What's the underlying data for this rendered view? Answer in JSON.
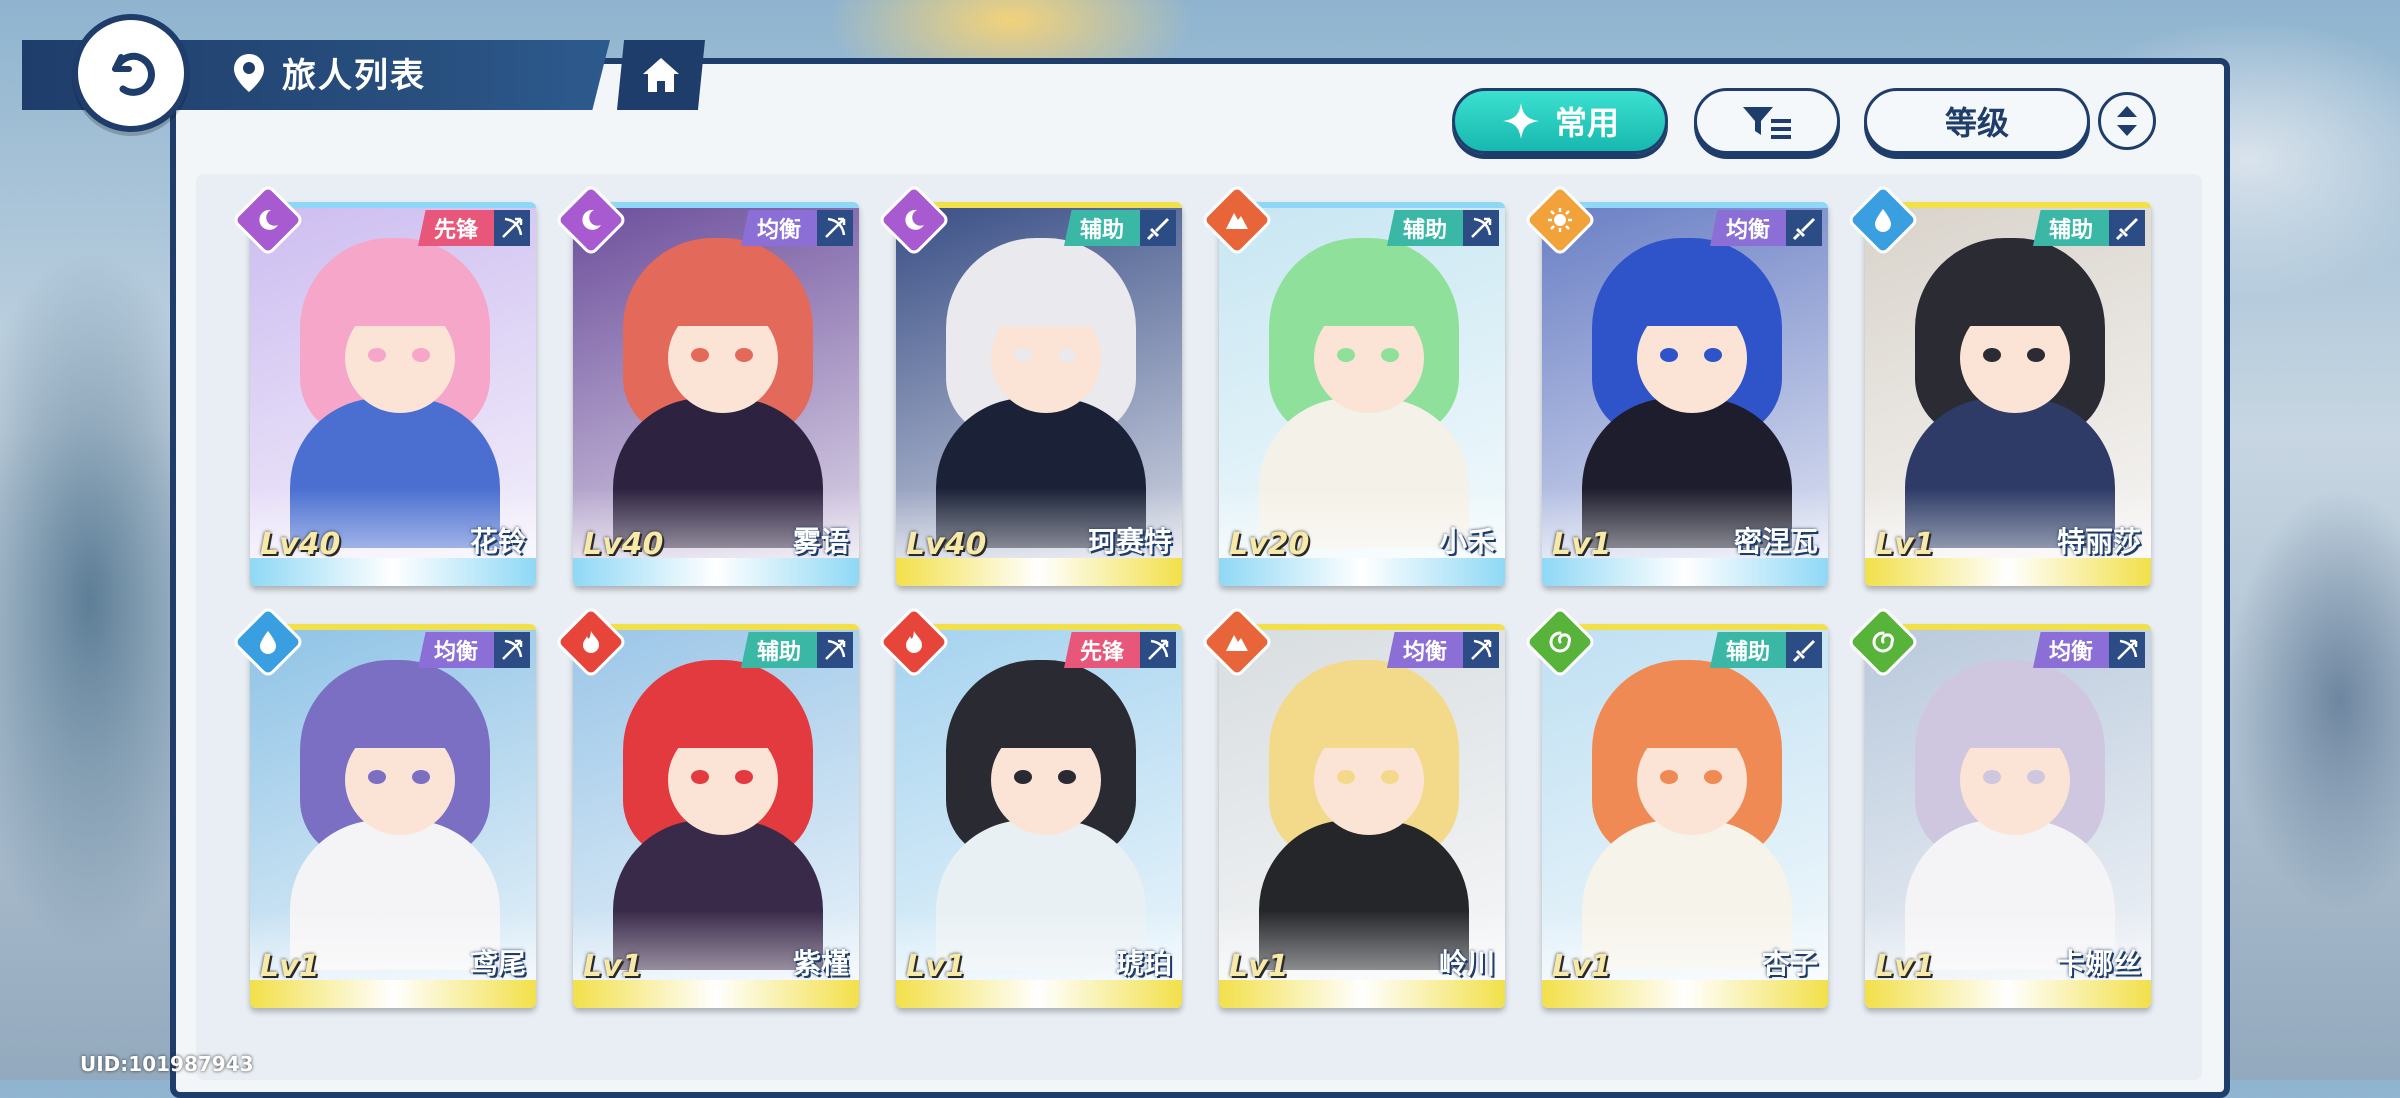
{
  "header": {
    "title": "旅人列表"
  },
  "controls": {
    "common_label": "常用",
    "sort_label": "等级"
  },
  "uid": "UID:101987943",
  "colors": {
    "navy": "#1f3d6b",
    "teal": "#1cc4b9"
  },
  "characters": [
    {
      "name": "花铃",
      "level": "Lv40",
      "role": "先锋",
      "element": "moon",
      "role_color": "#e8577a",
      "rarity_color": "#8fd8f5",
      "hair": "#f6a6c8",
      "outfit": "#4b6fd1",
      "bg": "#cdbdf0",
      "weapon": "bow-icon"
    },
    {
      "name": "雾语",
      "level": "Lv40",
      "role": "均衡",
      "element": "moon",
      "role_color": "#8b6fd6",
      "rarity_color": "#8fd8f5",
      "hair": "#e36a5a",
      "outfit": "#2d2240",
      "bg": "#6d4f9c",
      "weapon": "bow-icon"
    },
    {
      "name": "珂赛特",
      "level": "Lv40",
      "role": "辅助",
      "element": "moon",
      "role_color": "#3bb7a6",
      "rarity_color": "#f2e04a",
      "hair": "#e9e9ee",
      "outfit": "#1b2238",
      "bg": "#3a4f86",
      "weapon": "sword-icon"
    },
    {
      "name": "小禾",
      "level": "Lv20",
      "role": "辅助",
      "element": "earth",
      "role_color": "#3bb7a6",
      "rarity_color": "#8fd8f5",
      "hair": "#8fe09a",
      "outfit": "#f4f1e8",
      "bg": "#c7e6f2",
      "weapon": "bow-icon"
    },
    {
      "name": "密涅瓦",
      "level": "Lv1",
      "role": "均衡",
      "element": "sun",
      "role_color": "#8b6fd6",
      "rarity_color": "#8fd8f5",
      "hair": "#2f54c9",
      "outfit": "#1d1d2d",
      "bg": "#6a7fc5",
      "weapon": "sword-icon"
    },
    {
      "name": "特丽莎",
      "level": "Lv1",
      "role": "辅助",
      "element": "water",
      "role_color": "#3bb7a6",
      "rarity_color": "#f2e04a",
      "hair": "#2b2b34",
      "outfit": "#2d3b66",
      "bg": "#d9d3cb",
      "weapon": "sword-icon"
    },
    {
      "name": "鸢尾",
      "level": "Lv1",
      "role": "均衡",
      "element": "water",
      "role_color": "#8b6fd6",
      "rarity_color": "#f2e04a",
      "hair": "#7a6fc2",
      "outfit": "#f4f4f6",
      "bg": "#8fc3e6",
      "weapon": "bow-icon"
    },
    {
      "name": "紫槿",
      "level": "Lv1",
      "role": "辅助",
      "element": "fire",
      "role_color": "#3bb7a6",
      "rarity_color": "#f2e04a",
      "hair": "#e23a3f",
      "outfit": "#3a2a4a",
      "bg": "#9bc6e8",
      "weapon": "bow-icon"
    },
    {
      "name": "琥珀",
      "level": "Lv1",
      "role": "先锋",
      "element": "fire",
      "role_color": "#e8577a",
      "rarity_color": "#f2e04a",
      "hair": "#2a2a33",
      "outfit": "#e8f0f4",
      "bg": "#a5d3ef",
      "weapon": "bow-icon"
    },
    {
      "name": "岭川",
      "level": "Lv1",
      "role": "均衡",
      "element": "earth",
      "role_color": "#8b6fd6",
      "rarity_color": "#f2e04a",
      "hair": "#f3d98a",
      "outfit": "#24262a",
      "bg": "#d8dde0",
      "weapon": "bow-icon"
    },
    {
      "name": "杏子",
      "level": "Lv1",
      "role": "辅助",
      "element": "wind",
      "role_color": "#3bb7a6",
      "rarity_color": "#f2e04a",
      "hair": "#f08a55",
      "outfit": "#f6f3ea",
      "bg": "#bfe0f2",
      "weapon": "sword-icon"
    },
    {
      "name": "卡娜丝",
      "level": "Lv1",
      "role": "均衡",
      "element": "wind",
      "role_color": "#8b6fd6",
      "rarity_color": "#f2e04a",
      "hair": "#cfc6e0",
      "outfit": "#f4f4f7",
      "bg": "#b9c9dc",
      "weapon": "bow-icon"
    }
  ]
}
